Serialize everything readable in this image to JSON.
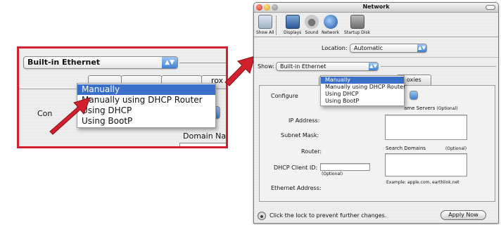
{
  "zoom_panel": {
    "interface_popup": "Built-in Ethernet",
    "configure_label_partial": "Con",
    "configure_label_tail": "re",
    "domain_partial": "Domain Nan",
    "tab_partial": "rox",
    "menu_items": [
      "Manually",
      "Manually using DHCP Router",
      "Using DHCP",
      "Using BootP"
    ],
    "selected_index": 0
  },
  "window": {
    "title": "Network",
    "toolbar": {
      "items": [
        {
          "label": "Show All",
          "icon": "show-all-icon"
        },
        {
          "label": "Displays",
          "icon": "displays-icon"
        },
        {
          "label": "Sound",
          "icon": "sound-icon"
        },
        {
          "label": "Network",
          "icon": "network-icon"
        },
        {
          "label": "Startup Disk",
          "icon": "startup-disk-icon"
        }
      ]
    },
    "location_label": "Location:",
    "location_value": "Automatic",
    "show_label": "Show:",
    "show_value": "Built-in Ethernet",
    "tab_visible_label": "oxies",
    "configure_label": "Configure",
    "dns_label": "Domain Name Servers",
    "dns_optional": "(Optional)",
    "dns_label_partial": "ame Servers",
    "ip_label": "IP Address:",
    "subnet_label": "Subnet Mask:",
    "router_label": "Router:",
    "search_domains_label": "Search Domains",
    "search_domains_optional": "(Optional)",
    "dhcp_client_label": "DHCP Client ID:",
    "dhcp_optional": "(Optional)",
    "example_text": "Example: apple.com, earthlink.net",
    "ethernet_label": "Ethernet Address:",
    "lock_text": "Click the lock to prevent further changes.",
    "apply_button": "Apply Now",
    "menu_items": [
      "Manually",
      "Manually using DHCP Router",
      "Using DHCP",
      "Using BootP"
    ],
    "selected_index": 0
  },
  "colors": {
    "highlight_red": "#d2202f",
    "menu_selection": "#3a6fc9"
  }
}
